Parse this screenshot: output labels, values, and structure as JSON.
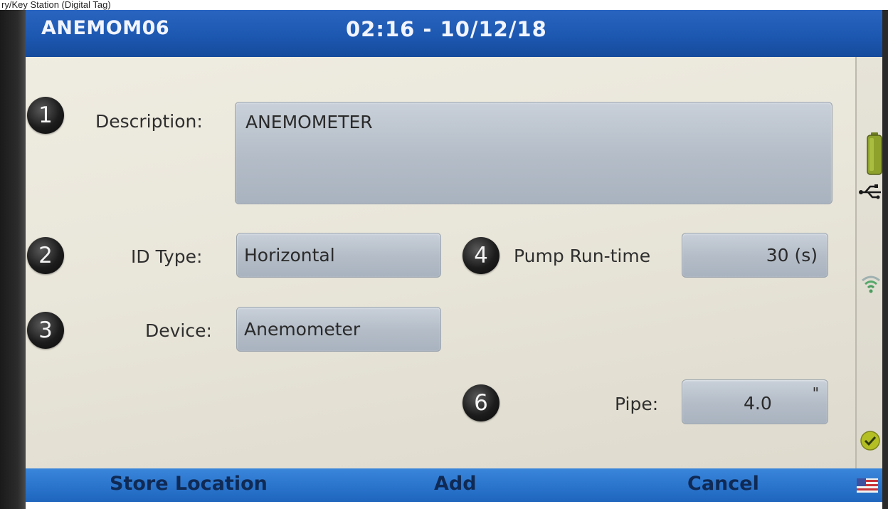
{
  "caption": "ry/Key Station (Digital Tag)",
  "header": {
    "device_id": "ANEMOM06",
    "datetime": "02:16 - 10/12/18"
  },
  "form": {
    "description": {
      "step": "1",
      "label": "Description:",
      "value": "ANEMOMETER"
    },
    "id_type": {
      "step": "2",
      "label": "ID Type:",
      "value": "Horizontal"
    },
    "device": {
      "step": "3",
      "label": "Device:",
      "value": "Anemometer"
    },
    "pump_runtime": {
      "step": "4",
      "label": "Pump Run-time",
      "value": "30 (s)"
    },
    "pipe": {
      "step": "6",
      "label": "Pipe:",
      "value": "4.0",
      "unit": "\""
    }
  },
  "softkeys": {
    "left": "Store Location",
    "center": "Add",
    "right": "Cancel"
  },
  "status_icons": [
    "battery-icon",
    "usb-icon",
    "wifi-icon",
    "check-icon",
    "flag-icon"
  ],
  "colors": {
    "title_bar": "#1c57b0",
    "bottom_bar": "#2a74cc",
    "field_fill": "#b3bcc7",
    "screen_bg": "#e9e6da"
  }
}
